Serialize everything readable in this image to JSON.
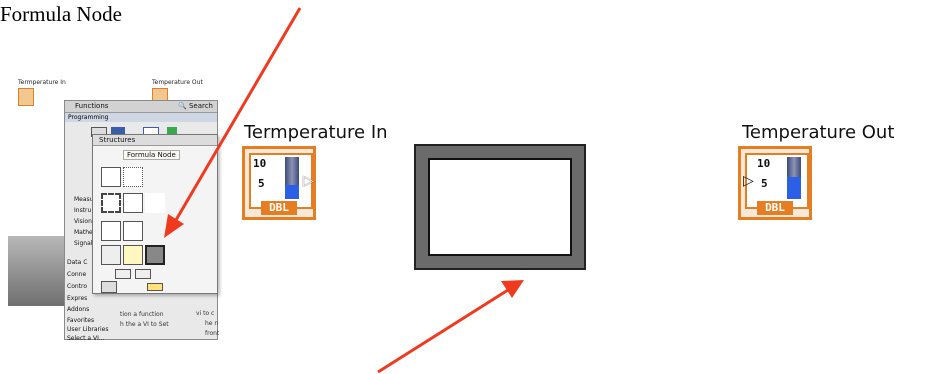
{
  "doc": {
    "title": "Formula Node"
  },
  "diagram": {
    "input_label": "Termperature In",
    "output_label": "Temperature Out",
    "tick_high": "10",
    "tick_mid": "5",
    "type_badge": "DBL"
  },
  "palette": {
    "mini_input_label": "Termperature In",
    "mini_output_label": "Temperature Out",
    "functions_title": "Functions",
    "search_label": "Search",
    "programming_label": "Programming",
    "structures_title": "Structures",
    "tooltip": "Formula Node",
    "categories": [
      "Measu",
      "Instru",
      "Vision",
      "Mathe",
      "Signal",
      "Data C",
      "Conne",
      "Contro",
      "Expres",
      "Addons",
      "Favorites",
      "User Libraries",
      "Select a VI..."
    ],
    "bg_text": [
      "vi to c",
      "he n",
      "front",
      "tion a function",
      "h the a VI to Set"
    ]
  },
  "colors": {
    "accent_orange": "#e57d22",
    "arrow_red": "#f03a1f"
  }
}
